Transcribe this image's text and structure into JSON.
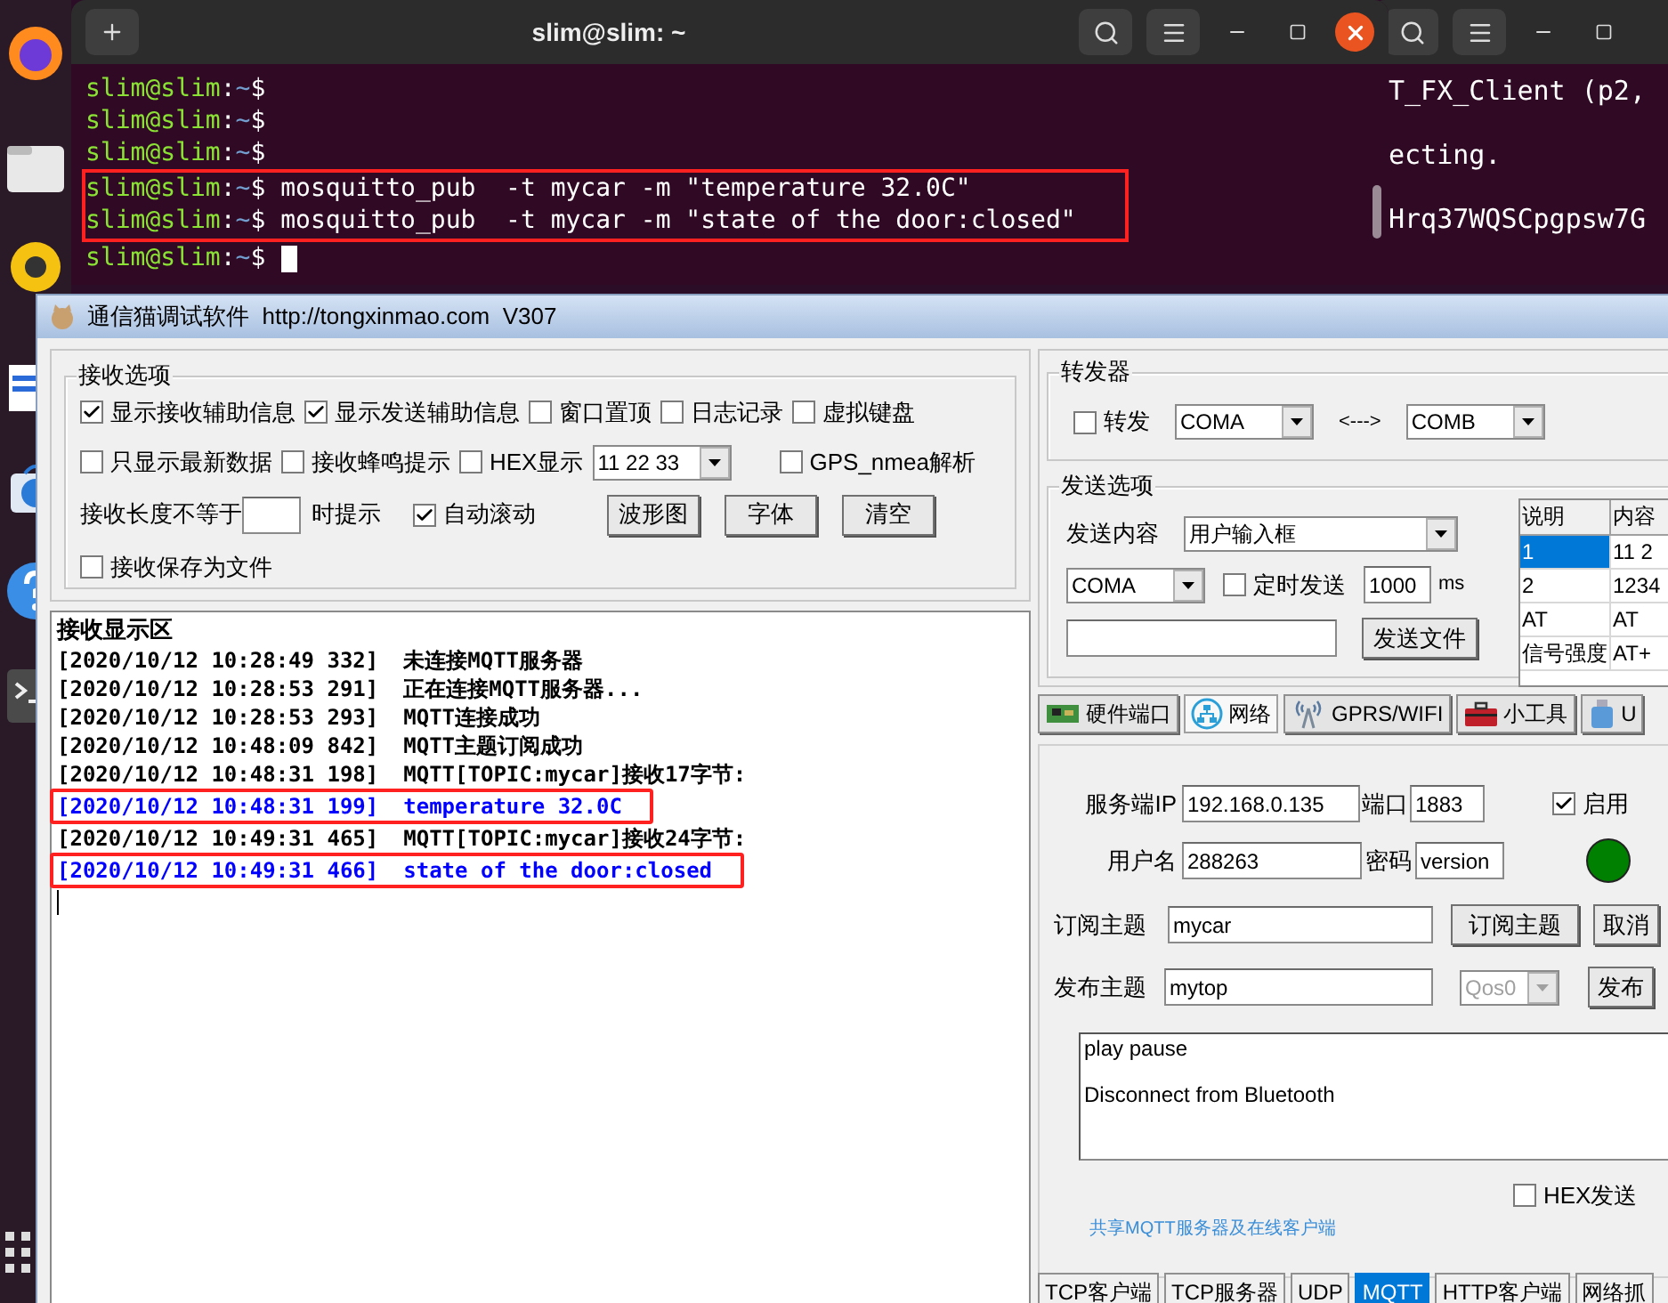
{
  "terminal": {
    "title": "slim@slim: ~",
    "cursor": true,
    "lines": [
      {
        "prompt": "slim@slim",
        "separator": ":",
        "path": "~",
        "symbol": "$",
        "boxed": false
      },
      {
        "prompt": "slim@slim",
        "separator": ":",
        "path": "~",
        "symbol": "$",
        "boxed": false
      },
      {
        "prompt": "slim@slim",
        "separator": ":",
        "path": "~",
        "symbol": "$",
        "boxed": false
      },
      {
        "prompt": "slim@slim",
        "separator": ":",
        "path": "~",
        "symbol": "$",
        "command": "mosquitto_pub  -t mycar -m \"temperature 32.0C\"",
        "boxed": true
      },
      {
        "prompt": "slim@slim",
        "separator": ":",
        "path": "~",
        "symbol": "$",
        "command": "mosquitto_pub  -t mycar -m \"state of the door:closed\"",
        "boxed": true
      },
      {
        "prompt": "slim@slim",
        "separator": ":",
        "path": "~",
        "symbol": "$",
        "boxed": false
      }
    ]
  },
  "background_terminal": {
    "lines": [
      "T_FX_Client (p2,",
      "ecting.",
      "Hrq37WQSCpgpsw7G"
    ]
  },
  "app": {
    "title": "通信猫调试软件  http://tongxinmao.com  V307",
    "receive_options": {
      "title": "接收选项",
      "row1": [
        {
          "label": "显示接收辅助信息",
          "checked": true
        },
        {
          "label": "显示发送辅助信息",
          "checked": true
        },
        {
          "label": "窗口置顶",
          "checked": false
        },
        {
          "label": "日志记录",
          "checked": false
        },
        {
          "label": "虚拟键盘",
          "checked": false
        }
      ],
      "row2": [
        {
          "label": "只显示最新数据",
          "checked": false
        },
        {
          "label": "接收蜂鸣提示",
          "checked": false
        },
        {
          "label": "HEX显示",
          "checked": false
        }
      ],
      "hex_format": "11 22 33",
      "gps": {
        "label": "GPS_nmea解析",
        "checked": false
      },
      "length_label": "接收长度不等于",
      "length_suffix": "时提示",
      "autoscroll": {
        "label": "自动滚动",
        "checked": true
      },
      "buttons": [
        "波形图",
        "字体",
        "清空"
      ],
      "save_to_file": {
        "label": "接收保存为文件",
        "checked": false
      }
    },
    "receive_area": {
      "title": "接收显示区",
      "lines": [
        {
          "time": "[2020/10/12 10:28:49 332]",
          "text": "未连接MQTT服务器",
          "color": "#000000",
          "boxed": false
        },
        {
          "time": "[2020/10/12 10:28:53 291]",
          "text": "正在连接MQTT服务器...",
          "color": "#000000",
          "boxed": false
        },
        {
          "time": "[2020/10/12 10:28:53 293]",
          "text": "MQTT连接成功",
          "color": "#000000",
          "boxed": false
        },
        {
          "time": "[2020/10/12 10:48:09 842]",
          "text": "MQTT主题订阅成功",
          "color": "#000000",
          "boxed": false
        },
        {
          "time": "[2020/10/12 10:48:31 198]",
          "text": "MQTT[TOPIC:mycar]接收17字节:",
          "color": "#000000",
          "boxed": false
        },
        {
          "time": "[2020/10/12 10:48:31 199]",
          "text": "temperature 32.0C",
          "color": "#0000ff",
          "boxed": true
        },
        {
          "time": "[2020/10/12 10:49:31 465]",
          "text": "MQTT[TOPIC:mycar]接收24字节:",
          "color": "#000000",
          "boxed": false
        },
        {
          "time": "[2020/10/12 10:49:31 466]",
          "text": "state of the door:closed",
          "color": "#0000ff",
          "boxed": true
        }
      ]
    },
    "forwarder": {
      "title": "转发器",
      "forward": {
        "label": "转发",
        "checked": false
      },
      "from": "COMA",
      "arrow": "<--->",
      "to": "COMB"
    },
    "send_options": {
      "title": "发送选项",
      "content_label": "发送内容",
      "content_source": "用户输入框",
      "port": "COMA",
      "timed": {
        "label": "定时发送",
        "checked": false
      },
      "interval": "1000",
      "unit": "ms",
      "send_file_button": "发送文件",
      "table": {
        "columns": [
          "说明",
          "内容"
        ],
        "rows": [
          {
            "cells": [
              "1",
              "11 2"
            ],
            "selected": true
          },
          {
            "cells": [
              "2",
              "1234"
            ],
            "selected": false
          },
          {
            "cells": [
              "AT",
              "AT"
            ],
            "selected": false
          },
          {
            "cells": [
              "信号强度",
              "AT+"
            ],
            "selected": false
          }
        ]
      }
    },
    "tool_tabs": [
      {
        "label": "硬件端口",
        "kind": "board",
        "selected": false
      },
      {
        "label": "网络",
        "kind": "network",
        "selected": true
      },
      {
        "label": "GPRS/WIFI",
        "kind": "antenna",
        "selected": false
      },
      {
        "label": "小工具",
        "kind": "toolbox",
        "selected": false
      },
      {
        "label": "U",
        "kind": "usb",
        "selected": false
      }
    ],
    "mqtt": {
      "server_ip_label": "服务端IP",
      "server_ip": "192.168.0.135",
      "port_label": "端口",
      "port": "1883",
      "enable": {
        "label": "启用",
        "checked": true
      },
      "username_label": "用户名",
      "username": "288263",
      "password_label": "密码",
      "password": "version",
      "connected": true,
      "subscribe_label": "订阅主题",
      "subscribe_topic": "mycar",
      "subscribe_button": "订阅主题",
      "unsubscribe_button": "取消",
      "publish_label": "发布主题",
      "publish_topic": "mytop",
      "qos": "Qos0",
      "qos_disabled": true,
      "publish_button": "发布",
      "message_lines": [
        "play pause",
        "Disconnect from Bluetooth"
      ],
      "hex_send": {
        "label": "HEX发送",
        "checked": false
      },
      "share_link": "共享MQTT服务器及在线客户端"
    },
    "protocol_tabs": [
      {
        "label": "TCP客户端",
        "selected": false
      },
      {
        "label": "TCP服务器",
        "selected": false
      },
      {
        "label": "UDP",
        "selected": false
      },
      {
        "label": "MQTT",
        "selected": true
      },
      {
        "label": "HTTP客户端",
        "selected": false
      },
      {
        "label": "网络抓",
        "selected": false
      }
    ]
  }
}
